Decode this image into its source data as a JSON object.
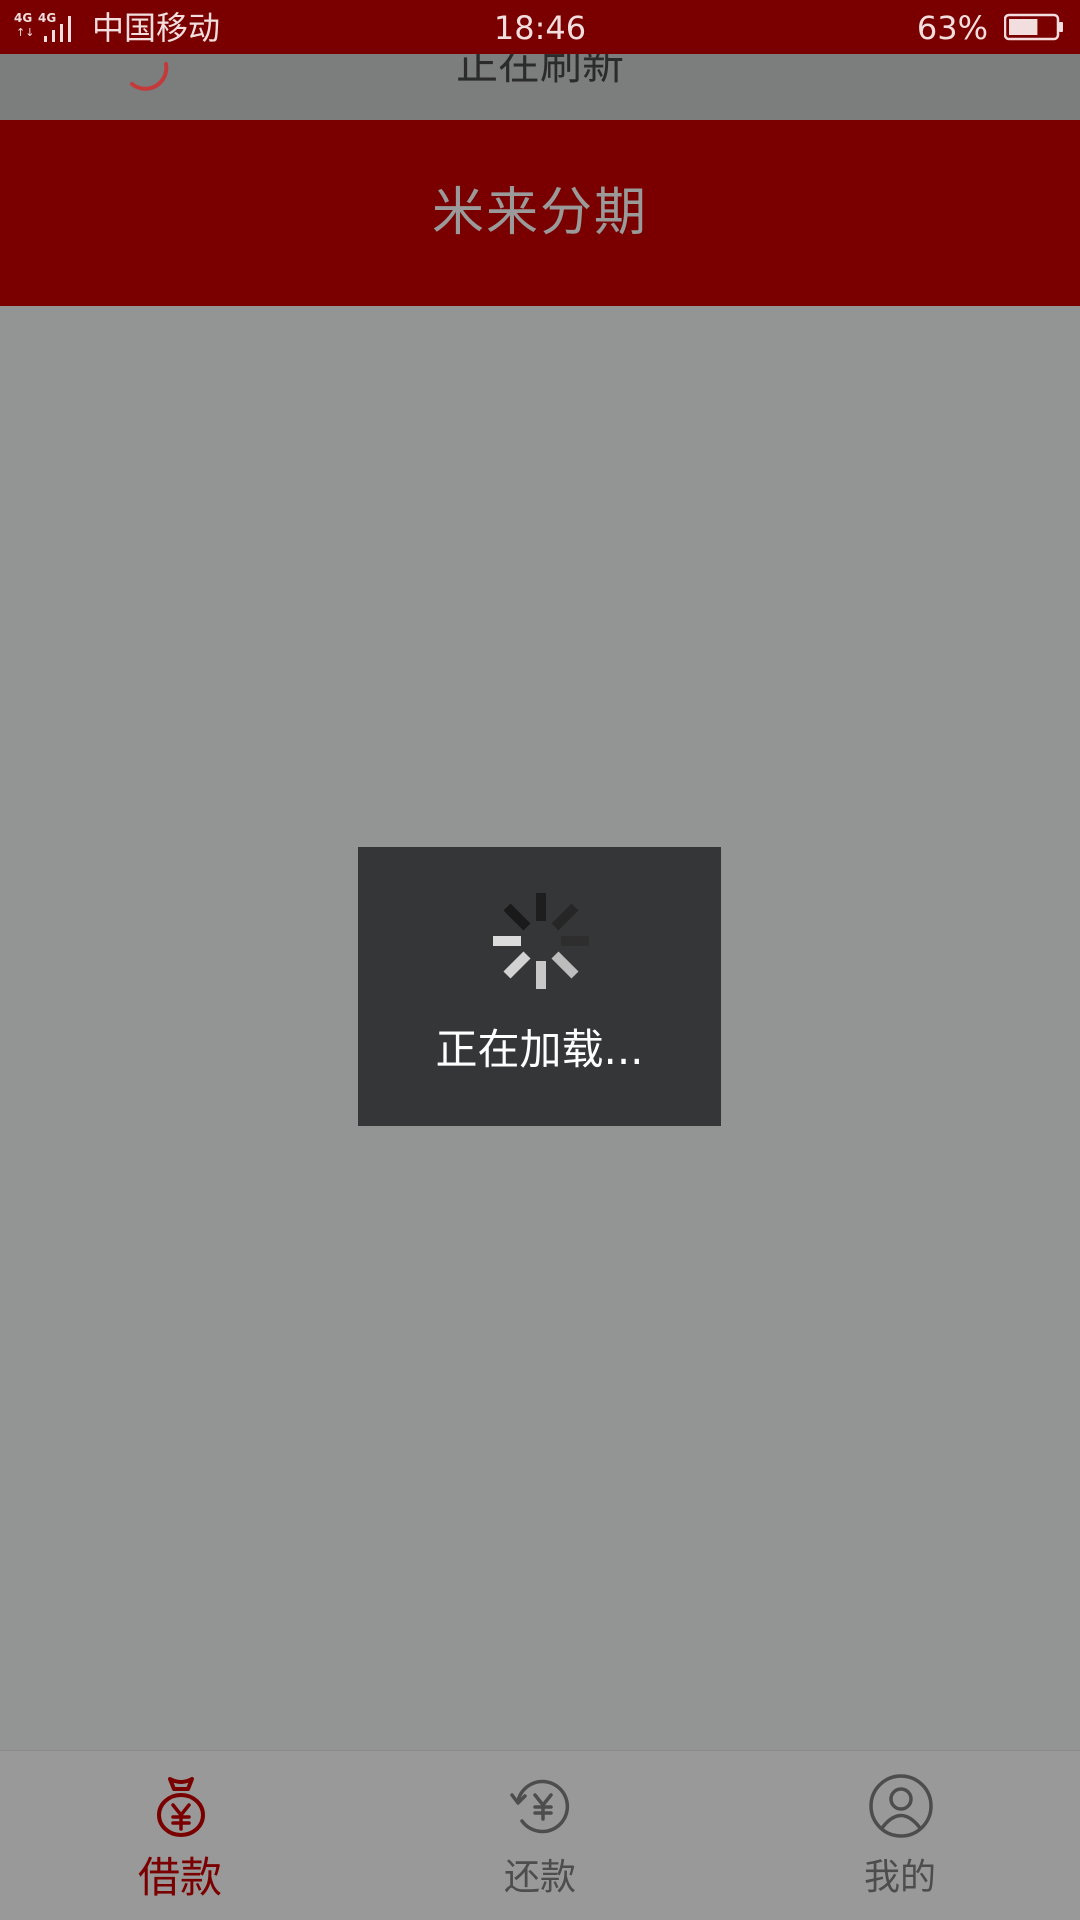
{
  "status_bar": {
    "network": "4G 4G",
    "carrier": "中国移动",
    "time": "18:46",
    "battery_percent": "63%",
    "battery_level": 0.63
  },
  "refresh": {
    "text": "正在刷新"
  },
  "header": {
    "title": "米来分期"
  },
  "loading": {
    "text": "正在加载..."
  },
  "bottom_nav": {
    "tabs": [
      {
        "label": "借款",
        "icon": "money-bag-icon",
        "active": true
      },
      {
        "label": "还款",
        "icon": "repay-icon",
        "active": false
      },
      {
        "label": "我的",
        "icon": "profile-icon",
        "active": false
      }
    ]
  },
  "colors": {
    "brand": "#7a0000",
    "overlay_gray": "#939494",
    "toast_bg": "#353638",
    "inactive_tab": "#4d4d4d"
  }
}
